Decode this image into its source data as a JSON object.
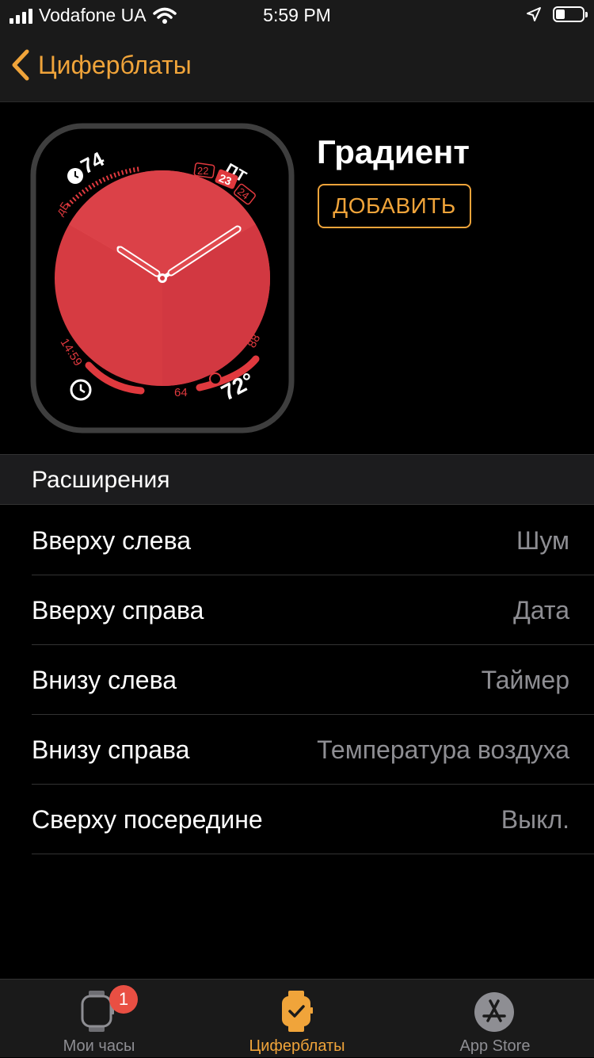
{
  "status_bar": {
    "carrier": "Vodafone UA",
    "time": "5:59 PM"
  },
  "nav": {
    "back_label": "Циферблаты"
  },
  "face": {
    "name": "Градиент",
    "add_label": "ДОБАВИТЬ",
    "complications": {
      "noise_value": "74",
      "noise_unit": "дБ",
      "day_name": "ПТ",
      "dates": [
        "22",
        "23",
        "24"
      ],
      "timer_value": "14:59",
      "temp_min": "64",
      "temp_max": "88",
      "temp_current": "72°"
    },
    "colors": {
      "accent": "#e0393e",
      "dial_light": "#ee6a62",
      "dial_dark": "#d63b42"
    }
  },
  "extensions": {
    "header": "Расширения",
    "rows": [
      {
        "label": "Вверху слева",
        "value": "Шум"
      },
      {
        "label": "Вверху справа",
        "value": "Дата"
      },
      {
        "label": "Внизу слева",
        "value": "Таймер"
      },
      {
        "label": "Внизу справа",
        "value": "Температура воздуха"
      },
      {
        "label": "Сверху посередине",
        "value": "Выкл."
      }
    ]
  },
  "tabbar": {
    "tabs": [
      {
        "label": "Мои часы",
        "icon": "watch-icon",
        "badge": "1"
      },
      {
        "label": "Циферблаты",
        "icon": "watch-faces-icon",
        "active": true
      },
      {
        "label": "App Store",
        "icon": "app-store-icon"
      }
    ]
  },
  "theme": {
    "accent": "#f0a43a",
    "secondary_text": "#8e8e93"
  }
}
